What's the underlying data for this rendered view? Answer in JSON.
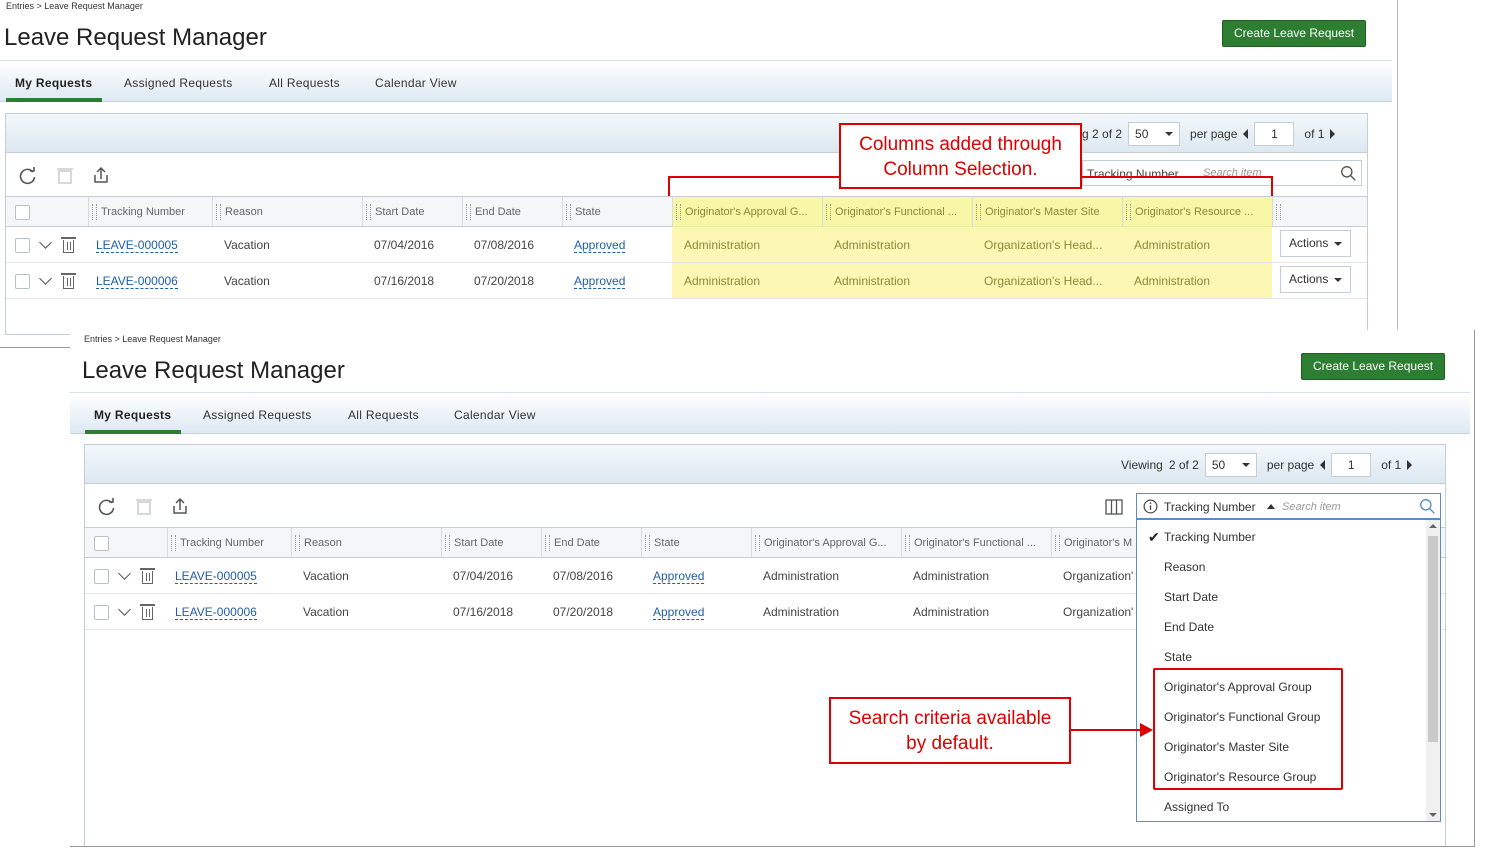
{
  "breadcrumb": "Entries > Leave Request Manager",
  "page_title": "Leave Request Manager",
  "create_button": "Create Leave Request",
  "tabs": [
    {
      "label": "My Requests",
      "active": true
    },
    {
      "label": "Assigned Requests",
      "active": false
    },
    {
      "label": "All Requests",
      "active": false
    },
    {
      "label": "Calendar View",
      "active": false
    }
  ],
  "pager": {
    "viewing_label": "Viewing",
    "count": "2 of 2",
    "top_partial": "g 2 of 2",
    "per_page_value": "50",
    "per_page_label": "per page",
    "page": "1",
    "of_pages": "of 1"
  },
  "search": {
    "field": "Tracking Number",
    "placeholder": "Search item"
  },
  "columns": [
    "Tracking Number",
    "Reason",
    "Start Date",
    "End Date",
    "State",
    "Originator's Approval G...",
    "Originator's Functional ...",
    "Originator's Master Site",
    "Originator's Resource ..."
  ],
  "columns_bottom_truncated": "Originator's M",
  "rows": [
    {
      "tracking": "LEAVE-000005",
      "reason": "Vacation",
      "start": "07/04/2016",
      "end": "07/08/2016",
      "state": "Approved",
      "approval": "Administration",
      "functional": "Administration",
      "master": "Organization's Head...",
      "resource": "Administration",
      "master_truncated": "Organization'",
      "action": "Actions"
    },
    {
      "tracking": "LEAVE-000006",
      "reason": "Vacation",
      "start": "07/16/2018",
      "end": "07/20/2018",
      "state": "Approved",
      "approval": "Administration",
      "functional": "Administration",
      "master": "Organization's Head...",
      "resource": "Administration",
      "master_truncated": "Organization'",
      "action": "Actions"
    }
  ],
  "dropdown_items": [
    "Tracking Number",
    "Reason",
    "Start Date",
    "End Date",
    "State",
    "Originator's Approval Group",
    "Originator's Functional Group",
    "Originator's Master Site",
    "Originator's Resource Group",
    "Assigned To"
  ],
  "callouts": {
    "top_line1": "Columns added through",
    "top_line2": "Column Selection.",
    "bottom_line1": "Search criteria available",
    "bottom_line2": "by default."
  },
  "colors": {
    "accent_green": "#2d7d32",
    "link_blue": "#1f5fa8",
    "callout_red": "#dd0000",
    "highlight_yellow": "#faf58c"
  }
}
